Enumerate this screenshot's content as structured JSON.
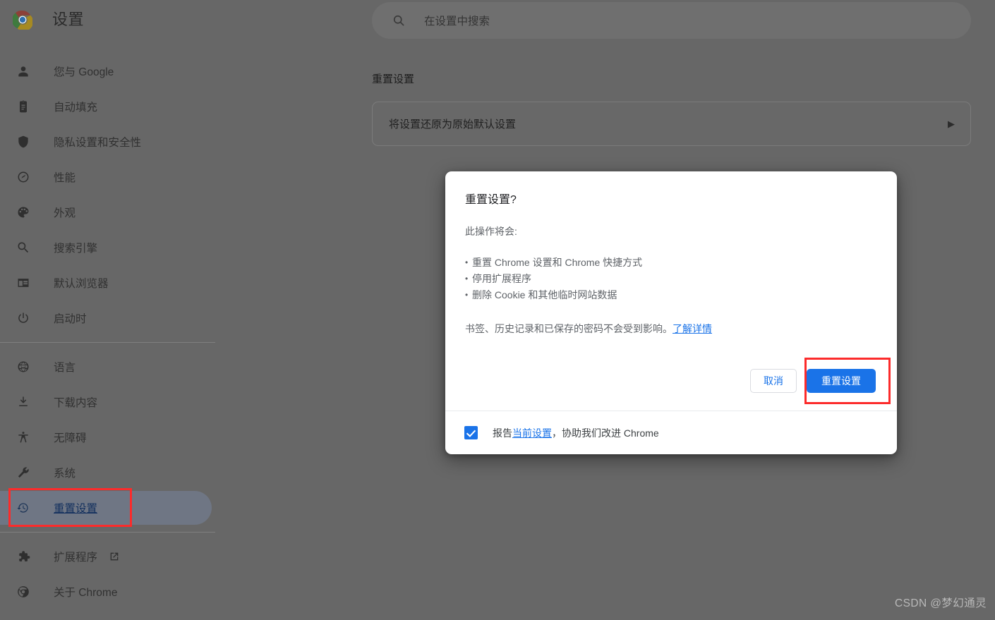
{
  "app": {
    "title": "设置",
    "logo_icon": "chrome-logo-icon",
    "watermark": "CSDN @梦幻通灵"
  },
  "search": {
    "icon": "search-icon",
    "placeholder": "在设置中搜索",
    "value": ""
  },
  "sidebar": {
    "items": [
      {
        "label": "您与 Google",
        "icon": "person-icon",
        "selected": false,
        "external": false
      },
      {
        "label": "自动填充",
        "icon": "clipboard-icon",
        "selected": false,
        "external": false
      },
      {
        "label": "隐私设置和安全性",
        "icon": "shield-icon",
        "selected": false,
        "external": false
      },
      {
        "label": "性能",
        "icon": "speedometer-icon",
        "selected": false,
        "external": false
      },
      {
        "label": "外观",
        "icon": "palette-icon",
        "selected": false,
        "external": false
      },
      {
        "label": "搜索引擎",
        "icon": "search-icon",
        "selected": false,
        "external": false
      },
      {
        "label": "默认浏览器",
        "icon": "browser-window-icon",
        "selected": false,
        "external": false
      },
      {
        "label": "启动时",
        "icon": "power-icon",
        "selected": false,
        "external": false
      },
      {
        "separator": true
      },
      {
        "label": "语言",
        "icon": "globe-icon",
        "selected": false,
        "external": false
      },
      {
        "label": "下载内容",
        "icon": "download-icon",
        "selected": false,
        "external": false
      },
      {
        "label": "无障碍",
        "icon": "accessibility-icon",
        "selected": false,
        "external": false
      },
      {
        "label": "系统",
        "icon": "wrench-icon",
        "selected": false,
        "external": false
      },
      {
        "label": "重置设置",
        "icon": "history-restore-icon",
        "selected": true,
        "external": false
      },
      {
        "separator": true
      },
      {
        "label": "扩展程序",
        "icon": "puzzle-icon",
        "selected": false,
        "external": true,
        "external_icon": "open-in-new-icon"
      },
      {
        "label": "关于 Chrome",
        "icon": "chrome-outline-icon",
        "selected": false,
        "external": false
      }
    ]
  },
  "main": {
    "section_title": "重置设置",
    "card": {
      "label": "将设置还原为原始默认设置",
      "arrow_icon": "chevron-right-icon"
    }
  },
  "dialog": {
    "title": "重置设置?",
    "lead": "此操作将会:",
    "bullets": [
      "重置 Chrome 设置和 Chrome 快捷方式",
      "停用扩展程序",
      "删除 Cookie 和其他临时网站数据"
    ],
    "footnote_text": "书签、历史记录和已保存的密码不会受到影响。",
    "footnote_link": "了解详情",
    "cancel_label": "取消",
    "confirm_label": "重置设置",
    "checkbox": {
      "checked": true,
      "text_before": "报告",
      "link": "当前设置",
      "text_after": "，协助我们改进 Chrome"
    }
  },
  "annotations": [
    {
      "name": "sidebar-reset-settings-highlight",
      "color": "#fc2b2b"
    },
    {
      "name": "reset-confirm-button-highlight",
      "color": "#fc2b2b"
    }
  ],
  "colors": {
    "scrim": "#676767",
    "accent_blue": "#1a73e8",
    "annotation_red": "#fc2b2b",
    "dialog_bg": "#ffffff",
    "selected_pill": "#6f7684"
  }
}
